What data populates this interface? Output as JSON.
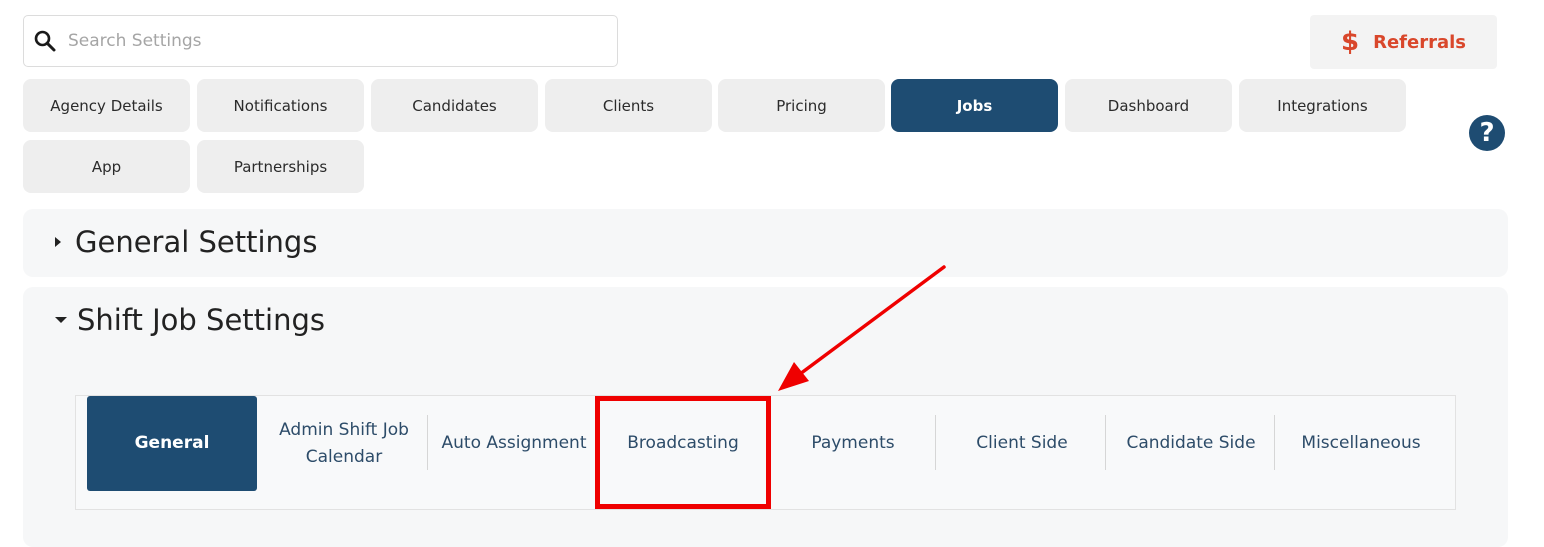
{
  "search": {
    "placeholder": "Search Settings",
    "value": ""
  },
  "referrals": {
    "icon": "$",
    "label": "Referrals",
    "color": "#d9472b"
  },
  "help": {
    "icon": "?"
  },
  "main_tabs": [
    {
      "label": "Agency Details"
    },
    {
      "label": "Notifications"
    },
    {
      "label": "Candidates"
    },
    {
      "label": "Clients"
    },
    {
      "label": "Pricing"
    },
    {
      "label": "Jobs",
      "active": true
    },
    {
      "label": "Dashboard"
    },
    {
      "label": "Integrations"
    },
    {
      "label": "App"
    },
    {
      "label": "Partnerships"
    }
  ],
  "sections": {
    "general": {
      "title": "General Settings",
      "expanded": false
    },
    "shift_job": {
      "title": "Shift Job Settings",
      "expanded": true
    }
  },
  "sub_tabs": [
    {
      "label": "General",
      "active": true
    },
    {
      "label": "Admin Shift Job Calendar"
    },
    {
      "label": "Auto Assignment"
    },
    {
      "label": "Broadcasting",
      "highlighted": true
    },
    {
      "label": "Payments"
    },
    {
      "label": "Client Side"
    },
    {
      "label": "Candidate Side"
    },
    {
      "label": "Miscellaneous"
    }
  ],
  "colors": {
    "accent": "#1e4c72",
    "tab_bg": "#eeeeee",
    "annotation": "#ef0000"
  }
}
